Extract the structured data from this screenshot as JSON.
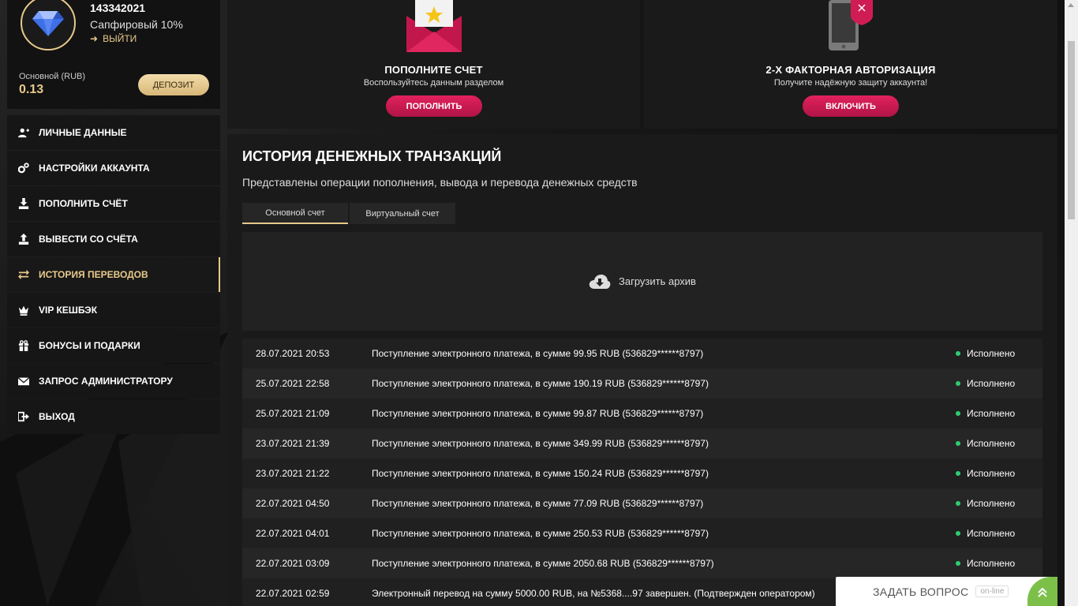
{
  "profile": {
    "username": "143342021",
    "level": "Сапфировый 10%",
    "logout_label": "ВЫЙТИ",
    "balance_label": "Основной (RUB)",
    "balance_value": "0.13",
    "deposit_label": "ДЕПОЗИТ"
  },
  "menu": [
    {
      "label": "ЛИЧНЫЕ ДАННЫЕ",
      "icon": "user-plus-icon"
    },
    {
      "label": "НАСТРОЙКИ АККАУНТА",
      "icon": "gears-icon"
    },
    {
      "label": "ПОПОЛНИТЬ СЧЁТ",
      "icon": "download-icon"
    },
    {
      "label": "ВЫВЕСТИ СО СЧЁТА",
      "icon": "upload-icon"
    },
    {
      "label": "ИСТОРИЯ ПЕРЕВОДОВ",
      "icon": "transfer-icon",
      "active": true
    },
    {
      "label": "VIP КЕШБЭК",
      "icon": "crown-icon"
    },
    {
      "label": "БОНУСЫ И ПОДАРКИ",
      "icon": "gift-icon"
    },
    {
      "label": "ЗАПРОС АДМИНИСТРАТОРУ",
      "icon": "envelope-icon"
    },
    {
      "label": "ВЫХОД",
      "icon": "exit-icon"
    }
  ],
  "cards": {
    "deposit": {
      "title": "ПОПОЛНИТЕ СЧЕТ",
      "subtitle": "Воспользуйтесь данным разделом",
      "button": "ПОПОЛНИТЬ"
    },
    "twofa": {
      "title": "2-Х ФАКТОРНАЯ АВТОРИЗАЦИЯ",
      "subtitle": "Получите надёжную защиту аккаунта!",
      "button": "ВКЛЮЧИТЬ"
    }
  },
  "history": {
    "title": "ИСТОРИЯ ДЕНЕЖНЫХ ТРАНЗАКЦИЙ",
    "subtitle": "Представлены операции пополнения, вывода и перевода денежных средств",
    "tabs": [
      "Основной счет",
      "Виртуальный счет"
    ],
    "archive_label": "Загрузить архив",
    "rows": [
      {
        "date": "28.07.2021 20:53",
        "desc": "Поступление электронного платежа, в сумме 99.95 RUB (536829******8797)",
        "status": "Исполнено"
      },
      {
        "date": "25.07.2021 22:58",
        "desc": "Поступление электронного платежа, в сумме 190.19 RUB (536829******8797)",
        "status": "Исполнено"
      },
      {
        "date": "25.07.2021 21:09",
        "desc": "Поступление электронного платежа, в сумме 99.87 RUB (536829******8797)",
        "status": "Исполнено"
      },
      {
        "date": "23.07.2021 21:39",
        "desc": "Поступление электронного платежа, в сумме 349.99 RUB (536829******8797)",
        "status": "Исполнено"
      },
      {
        "date": "23.07.2021 21:22",
        "desc": "Поступление электронного платежа, в сумме 150.24 RUB (536829******8797)",
        "status": "Исполнено"
      },
      {
        "date": "22.07.2021 04:50",
        "desc": "Поступление электронного платежа, в сумме 77.09 RUB (536829******8797)",
        "status": "Исполнено"
      },
      {
        "date": "22.07.2021 04:01",
        "desc": "Поступление электронного платежа, в сумме 250.53 RUB (536829******8797)",
        "status": "Исполнено"
      },
      {
        "date": "22.07.2021 03:09",
        "desc": "Поступление электронного платежа, в сумме 2050.68 RUB (536829******8797)",
        "status": "Исполнено"
      },
      {
        "date": "22.07.2021 02:59",
        "desc": "Электронный перевод на сумму 5000.00 RUB, на №5368....97 завершен. (Подтвержден оператором)",
        "status": ""
      }
    ]
  },
  "chat": {
    "label": "ЗАДАТЬ ВОПРОС",
    "status": "on-line"
  },
  "colors": {
    "accent_gold": "#e8c98a",
    "button_pink": "#d01c55",
    "status_green": "#2ecc71",
    "chat_green": "#7cc04a"
  }
}
